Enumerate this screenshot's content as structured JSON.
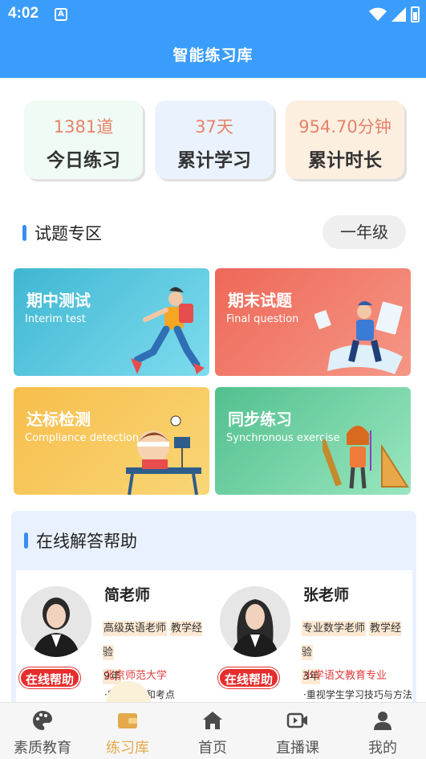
{
  "statusbar": {
    "time": "4:02",
    "app_icon_letter": "A"
  },
  "header": {
    "title": "智能练习库"
  },
  "stats": [
    {
      "value": "1381道",
      "label": "今日练习"
    },
    {
      "value": "37天",
      "label": "累计学习"
    },
    {
      "value": "954.70分钟",
      "label": "累计时长"
    }
  ],
  "question_zone": {
    "title": "试题专区",
    "grade": "一年级"
  },
  "cards": [
    {
      "title": "期中测试",
      "subtitle": "Interim test"
    },
    {
      "title": "期末试题",
      "subtitle": "Final question"
    },
    {
      "title": "达标检测",
      "subtitle": "Compliance detection"
    },
    {
      "title": "同步练习",
      "subtitle": "Synchronous exercise"
    }
  ],
  "online_help": {
    "title": "在线解答帮助",
    "teachers": [
      {
        "name": "简老师",
        "tag1": "高级英语老师",
        "tag2": "教学经验",
        "years": "9年",
        "school": "北京师范大学",
        "desc": "·熟悉教材和考点",
        "button": "在线帮助"
      },
      {
        "name": "张老师",
        "tag1": "专业数学老师",
        "tag2": "教学经验",
        "years": "3年",
        "school": "小学语文教育专业",
        "desc": "·重视学生学习技巧与方法",
        "button": "在线帮助"
      }
    ]
  },
  "nav": [
    {
      "label": "素质教育",
      "icon": "palette-icon"
    },
    {
      "label": "练习库",
      "icon": "wallet-icon"
    },
    {
      "label": "首页",
      "icon": "home-icon"
    },
    {
      "label": "直播课",
      "icon": "video-icon"
    },
    {
      "label": "我的",
      "icon": "user-icon"
    }
  ],
  "colors": {
    "primary": "#3a9dfb",
    "accent": "#e3a94a",
    "help_button": "#e62c2c"
  }
}
